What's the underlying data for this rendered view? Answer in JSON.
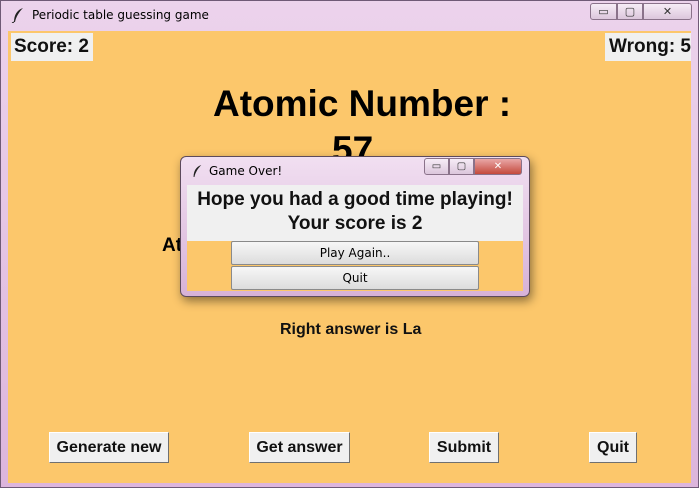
{
  "window": {
    "title": "Periodic table guessing game",
    "controls": {
      "minimize": "▭",
      "maximize": "▢",
      "close": "✕"
    }
  },
  "game": {
    "score_text": "Score: 2",
    "wrong_text": "Wrong: 5",
    "heading": "Atomic Number :",
    "number": "57",
    "partial_label": "At",
    "right_answer": "Right answer is La"
  },
  "buttons": {
    "generate": "Generate new",
    "get_answer": "Get answer",
    "submit": "Submit",
    "quit": "Quit"
  },
  "dialog": {
    "title": "Game Over!",
    "message_line1": "Hope you had a good time playing!",
    "message_line2": "Your score is 2",
    "play_again": "Play Again..",
    "quit": "Quit",
    "close_glyph": "✕"
  },
  "colors": {
    "background": "#fcc76b",
    "label_bg": "#f0f0f0",
    "title_bar": "#dcb5dc"
  },
  "icons": {
    "app": "feather-icon"
  }
}
